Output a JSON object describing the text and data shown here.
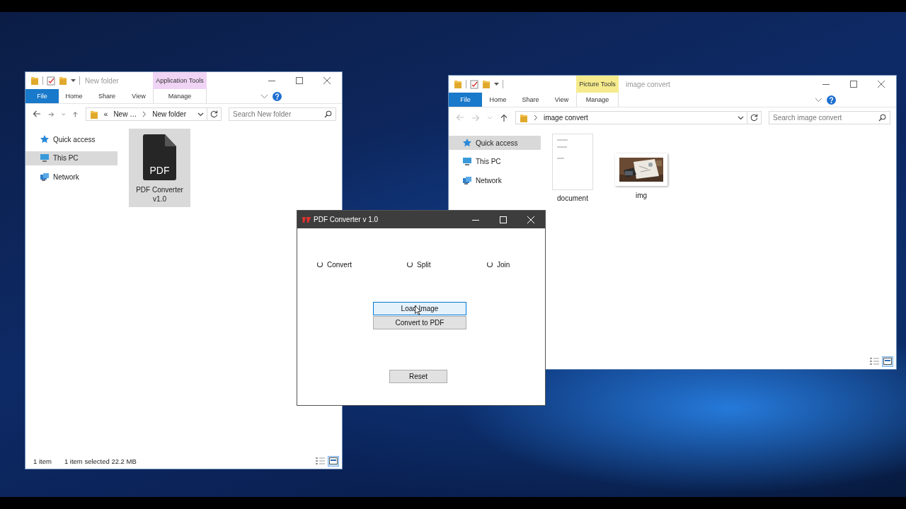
{
  "windows": [
    {
      "kind": "explorer",
      "title": "New folder",
      "tools_tab": {
        "label": "Application Tools",
        "color": "#f0d4f5"
      },
      "ribbon_tabs": [
        {
          "label": "File",
          "kind": "file"
        },
        {
          "label": "Home",
          "kind": "tab"
        },
        {
          "label": "Share",
          "kind": "tab"
        },
        {
          "label": "View",
          "kind": "tab"
        },
        {
          "label": "Manage",
          "kind": "tools"
        }
      ],
      "back_enabled": true,
      "breadcrumb": {
        "overflow": "«",
        "parts": [
          "New …",
          "New folder"
        ]
      },
      "search": {
        "placeholder": "Search New folder"
      },
      "nav": [
        {
          "label": "Quick access",
          "kind": "quick_access",
          "selected": false
        },
        {
          "label": "This PC",
          "kind": "this_pc",
          "selected": true
        },
        {
          "label": "Network",
          "kind": "network",
          "selected": false
        }
      ],
      "items": [
        {
          "name": "PDF Converter v1.0",
          "kind": "pdf",
          "badge": "PDF",
          "selected": true
        }
      ],
      "status": [
        "1 item",
        "1 item selected  22.2 MB"
      ]
    },
    {
      "kind": "explorer",
      "title": "image convert",
      "tools_tab": {
        "label": "Picture Tools",
        "color": "#f5eb8c"
      },
      "ribbon_tabs": [
        {
          "label": "File",
          "kind": "file"
        },
        {
          "label": "Home",
          "kind": "tab"
        },
        {
          "label": "Share",
          "kind": "tab"
        },
        {
          "label": "View",
          "kind": "tab"
        },
        {
          "label": "Manage",
          "kind": "tools"
        }
      ],
      "back_enabled": false,
      "breadcrumb": {
        "parts": [
          "image convert"
        ]
      },
      "search": {
        "placeholder": "Search image convert"
      },
      "nav": [
        {
          "label": "Quick access",
          "kind": "quick_access",
          "selected": true
        },
        {
          "label": "This PC",
          "kind": "this_pc",
          "selected": false
        },
        {
          "label": "Network",
          "kind": "network",
          "selected": false
        }
      ],
      "items": [
        {
          "name": "document",
          "kind": "document",
          "selected": false
        },
        {
          "name": "img",
          "kind": "picture",
          "selected": false
        }
      ]
    }
  ],
  "dialog": {
    "title": "PDF Converter v 1.0",
    "radios": [
      {
        "label": "Convert",
        "selected": false
      },
      {
        "label": "Split",
        "selected": false
      },
      {
        "label": "Join",
        "selected": false
      }
    ],
    "buttons": [
      {
        "label": "Load Image",
        "kind": "action",
        "hovered": true
      },
      {
        "label": "Convert to PDF",
        "kind": "action",
        "hovered": false
      },
      {
        "label": "Reset",
        "kind": "reset",
        "hovered": false
      }
    ]
  }
}
